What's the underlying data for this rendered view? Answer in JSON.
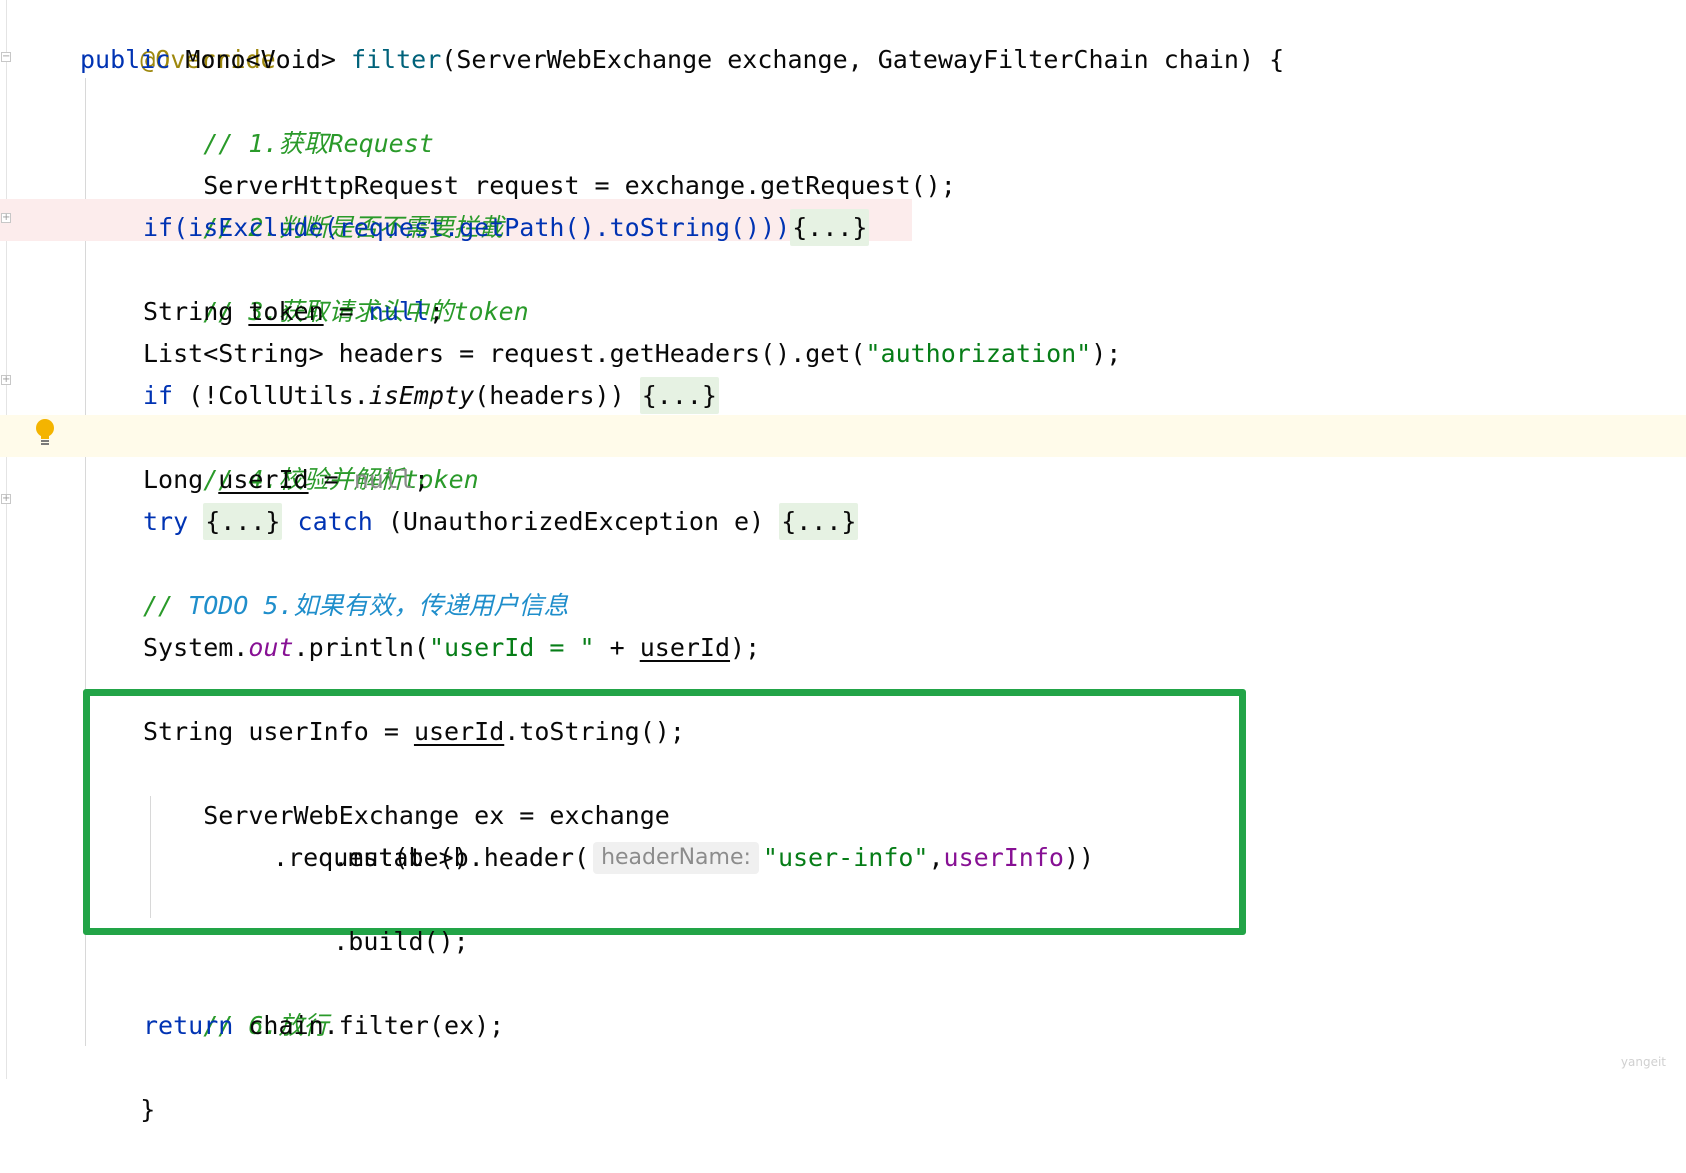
{
  "editor": {
    "lines": {
      "annotation": "@Override",
      "signature": {
        "kw_public": "public",
        "ret_type": "Mono<Void>",
        "method": "filter",
        "params": "(ServerWebExchange exchange, GatewayFilterChain chain) {"
      },
      "c1": "// 1.获取Request",
      "l_request": "ServerHttpRequest request = exchange.getRequest();",
      "c2": "// 2.判断是否不需要拦截",
      "l_if_exclude": {
        "code": "if(isExclude(request.getPath().toString()))",
        "fold": "{...}"
      },
      "c3": "// 3.获取请求头中的token",
      "l_token": {
        "type": "String ",
        "var": "token",
        "eq": " = ",
        "value": "null",
        "end": ";"
      },
      "l_headers": {
        "code": "List<String> headers = request.getHeaders().get(",
        "str": "\"authorization\"",
        "end": ");"
      },
      "l_if_empty": {
        "kw": "if",
        "pre": " (!CollUtils.",
        "static": "isEmpty",
        "post": "(headers)) ",
        "fold": "{...}"
      },
      "c4": "// 4.校验并解析token",
      "l_userid": {
        "type": "Long ",
        "var": "userId",
        "eq": " = ",
        "value": "null",
        "end": ";"
      },
      "l_try": {
        "kw_try": "try",
        "fold1": "{...}",
        "kw_catch": "catch",
        "mid": " (UnauthorizedException e) ",
        "fold2": "{...}"
      },
      "c5": {
        "slashes": "// ",
        "todo": "TODO 5.如果有效，传递用户信息"
      },
      "l_println": {
        "pre": "System.",
        "field": "out",
        "mid": ".println(",
        "str": "\"userId = \"",
        "plus": " + ",
        "var": "userId",
        "end": ");"
      },
      "l_userinfo": {
        "pre": "String userInfo = ",
        "var": "userId",
        "post": ".toString();"
      },
      "l_ex": "ServerWebExchange ex = exchange",
      "l_mutate": ".mutate()",
      "l_request_chain": {
        "pre": ".request(b->b.header(",
        "hint": "headerName:",
        "str": "\"user-info\"",
        "comma": ",",
        "var": "userInfo",
        "end": "))"
      },
      "l_build": ".build();",
      "c6": "// 6.放行",
      "l_return": {
        "kw": "return",
        "code": " chain.filter(ex);"
      },
      "close_brace": "}"
    },
    "icons": {
      "bulb": "lightbulb-icon",
      "fold": "fold-marker-icon"
    },
    "colors": {
      "keyword": "#0033b3",
      "string": "#067d17",
      "comment": "#8c8c8c",
      "comment_green": "#2a9a2a",
      "todo": "#1f8ecb",
      "highlight_box": "#22a447"
    },
    "watermark": "yangeit"
  }
}
